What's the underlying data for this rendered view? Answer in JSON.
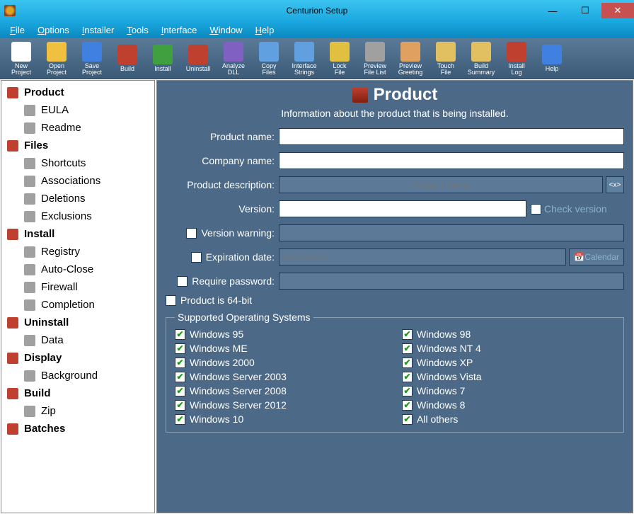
{
  "window": {
    "title": "Centurion Setup"
  },
  "menu": [
    "File",
    "Options",
    "Installer",
    "Tools",
    "Interface",
    "Window",
    "Help"
  ],
  "toolbar": [
    {
      "label": "New\nProject"
    },
    {
      "label": "Open\nProject"
    },
    {
      "label": "Save\nProject"
    },
    {
      "label": "Build"
    },
    {
      "label": "Install"
    },
    {
      "label": "Uninstall"
    },
    {
      "label": "Analyze\nDLL"
    },
    {
      "label": "Copy\nFiles"
    },
    {
      "label": "Interface\nStrings"
    },
    {
      "label": "Lock\nFile"
    },
    {
      "label": "Preview\nFile List"
    },
    {
      "label": "Preview\nGreeting"
    },
    {
      "label": "Touch\nFile"
    },
    {
      "label": "Build\nSummary"
    },
    {
      "label": "Install\nLog"
    },
    {
      "label": "Help"
    }
  ],
  "sidebar": [
    {
      "label": "Product",
      "group": true,
      "selected": true
    },
    {
      "label": "EULA",
      "child": true
    },
    {
      "label": "Readme",
      "child": true
    },
    {
      "label": "Files",
      "group": true
    },
    {
      "label": "Shortcuts",
      "child": true
    },
    {
      "label": "Associations",
      "child": true
    },
    {
      "label": "Deletions",
      "child": true
    },
    {
      "label": "Exclusions",
      "child": true
    },
    {
      "label": "Install",
      "group": true
    },
    {
      "label": "Registry",
      "child": true
    },
    {
      "label": "Auto-Close",
      "child": true
    },
    {
      "label": "Firewall",
      "child": true
    },
    {
      "label": "Completion",
      "child": true
    },
    {
      "label": "Uninstall",
      "group": true
    },
    {
      "label": "Data",
      "child": true
    },
    {
      "label": "Display",
      "group": true
    },
    {
      "label": "Background",
      "child": true
    },
    {
      "label": "Build",
      "group": true
    },
    {
      "label": "Zip",
      "child": true
    },
    {
      "label": "Batches",
      "group": true
    }
  ],
  "page": {
    "title": "Product",
    "subtitle": "Information about the product that is being installed.",
    "labels": {
      "product_name": "Product name:",
      "company_name": "Company name:",
      "product_description": "Product description:",
      "version": "Version:",
      "check_version": "Check version",
      "version_warning": "Version warning:",
      "expiration_date": "Expiration date:",
      "expiration_placeholder": "##/##/####",
      "calendar": "Calendar",
      "require_password": "Require password:",
      "is_64bit": "Product is 64-bit",
      "desc_placeholder": "Product Name",
      "desc_btn": "<x>"
    },
    "os_legend": "Supported Operating Systems",
    "os": [
      "Windows 95",
      "Windows 98",
      "Windows ME",
      "Windows NT 4",
      "Windows 2000",
      "Windows XP",
      "Windows Server 2003",
      "Windows Vista",
      "Windows Server 2008",
      "Windows 7",
      "Windows Server 2012",
      "Windows 8",
      "Windows 10",
      "All others"
    ]
  }
}
